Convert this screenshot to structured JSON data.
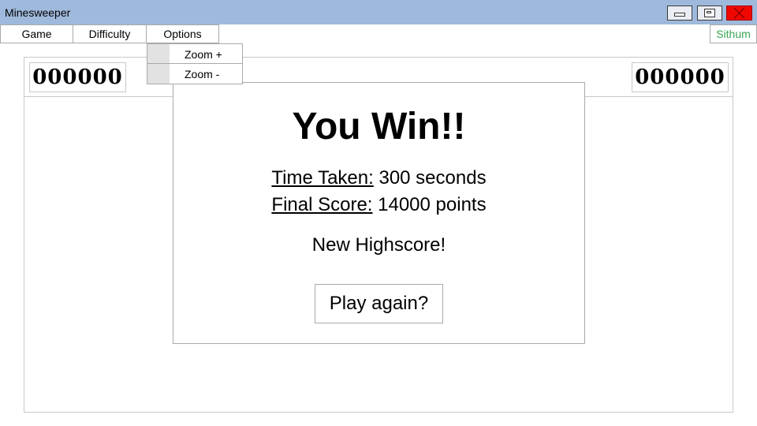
{
  "window": {
    "title": "Minesweeper",
    "controls": {
      "minimize_icon": "minimize-icon",
      "maximize_icon": "maximize-icon",
      "close_icon": "close-icon"
    },
    "close_color": "#f00800",
    "titlebar_color": "#9fb9dc"
  },
  "menu": {
    "game": "Game",
    "difficulty": "Difficulty",
    "options": "Options",
    "user": "Sithum",
    "user_color": "#3aa655"
  },
  "options_menu": {
    "items": [
      "Zoom +",
      "Zoom -"
    ]
  },
  "board": {
    "left_counter": "000000",
    "right_counter": "000000"
  },
  "dialog": {
    "title": "You Win!!",
    "time_label": "Time Taken:",
    "time_value": "300 seconds",
    "score_label": "Final Score:",
    "score_value": "14000 points",
    "highscore": "New Highscore!",
    "play_again": "Play again?"
  }
}
